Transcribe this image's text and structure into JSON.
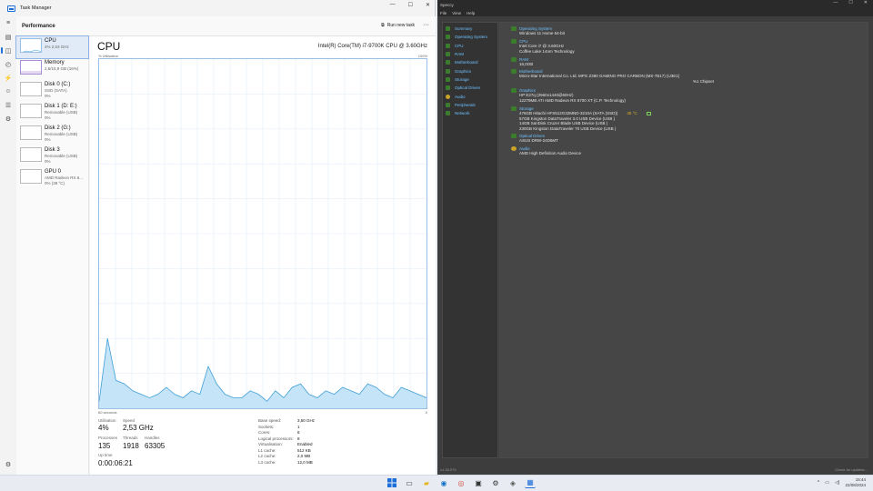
{
  "task_manager": {
    "title": "Task Manager",
    "window_controls": [
      "—",
      "☐",
      "✕"
    ],
    "header": "Performance",
    "run_new_task": "Run new task",
    "more": "···",
    "devices": [
      {
        "name": "CPU",
        "sub1": "4% 2,53 GHz",
        "sub2": "",
        "selected": true
      },
      {
        "name": "Memory",
        "sub1": "2,6/15,9 GB (16%)",
        "sub2": ""
      },
      {
        "name": "Disk 0 (C:)",
        "sub1": "SSD (SATA)",
        "sub2": "0%"
      },
      {
        "name": "Disk 1 (D: E:)",
        "sub1": "Removable (USB)",
        "sub2": "0%"
      },
      {
        "name": "Disk 2 (G:)",
        "sub1": "Removable (USB)",
        "sub2": "0%"
      },
      {
        "name": "Disk 3",
        "sub1": "Removable (USB)",
        "sub2": "0%"
      },
      {
        "name": "GPU 0",
        "sub1": "AMD Radeon RX 6...",
        "sub2": "0% (38 °C)"
      }
    ],
    "cpu": {
      "title": "CPU",
      "model": "Intel(R) Core(TM) i7-9700K CPU @ 3.60GHz",
      "util_label": "% Utilisation",
      "max_label": "100%",
      "seconds_label": "60 seconds",
      "zero_label": "0",
      "stats": {
        "utilisation_label": "Utilisation",
        "utilisation": "4%",
        "speed_label": "Speed",
        "speed": "2,53 GHz",
        "processes_label": "Processes",
        "processes": "135",
        "threads_label": "Threads",
        "threads": "1918",
        "handles_label": "Handles",
        "handles": "63305",
        "uptime_label": "Up time",
        "uptime": "0:00:06:21"
      },
      "details": [
        {
          "k": "Base speed:",
          "v": "3,60 GHz"
        },
        {
          "k": "Sockets:",
          "v": "1"
        },
        {
          "k": "Cores:",
          "v": "8"
        },
        {
          "k": "Logical processors:",
          "v": "8"
        },
        {
          "k": "Virtualisation:",
          "v": "Enabled"
        },
        {
          "k": "L1 cache:",
          "v": "512 KB"
        },
        {
          "k": "L2 cache:",
          "v": "2,0 MB"
        },
        {
          "k": "L3 cache:",
          "v": "12,0 MB"
        }
      ],
      "history_percent": [
        2,
        20,
        8,
        7,
        5,
        4,
        3,
        4,
        6,
        4,
        3,
        5,
        4,
        12,
        7,
        4,
        3,
        3,
        5,
        4,
        2,
        5,
        3,
        6,
        7,
        4,
        3,
        5,
        4,
        6,
        5,
        4,
        7,
        6,
        4,
        3,
        6,
        5,
        4,
        3
      ]
    }
  },
  "speccy": {
    "title": "Speccy",
    "window_controls": [
      "—",
      "☐",
      "✕"
    ],
    "menu": [
      "File",
      "View",
      "Help"
    ],
    "tree": [
      "Summary",
      "Operating System",
      "CPU",
      "RAM",
      "Motherboard",
      "Graphics",
      "Storage",
      "Optical Drives",
      "Audio",
      "Peripherals",
      "Network"
    ],
    "sections": [
      {
        "h": "Operating System",
        "lines": [
          "Windows 11 Home 64-bit"
        ]
      },
      {
        "h": "CPU",
        "lines": [
          "Intel Core i7 @ 3.60GHz",
          "Coffee Lake 14nm Technology"
        ]
      },
      {
        "h": "RAM",
        "lines": [
          "16,0GB"
        ]
      },
      {
        "h": "Motherboard",
        "lines": [
          "Micro-Star International Co. Ltd. MPG Z390 GAMING PRO CARBON (MS-7B17) (U3E1)"
        ],
        "extra": "%1 Chipset"
      },
      {
        "h": "Graphics",
        "lines": [
          "HP E27q (2560x1440@60Hz)",
          "12279MB ATI AMD Radeon RX 6700 XT (C.P. Technology)"
        ]
      },
      {
        "h": "Storage",
        "lines": [
          "476GB Hitachi HFS512G32MND-3210A (SATA (SSD))",
          "57GB Kingston DataTraveler 3.0 USB Device (USB )",
          "14GB SanDisk Cruzer Blade USB Device (USB )",
          "230GB Kingston DataTraveler 70 USB Device (USB )"
        ],
        "temp": "35 °C"
      },
      {
        "h": "Optical Drives",
        "lines": [
          "ASUS DRW-24D5MT"
        ]
      },
      {
        "h": "Audio",
        "lines": [
          "AMD High Definition Audio Device"
        ]
      }
    ],
    "version": "v1.33.079",
    "update": "Check for updates..."
  },
  "taskbar": {
    "time": "15:44",
    "date": "22/08/2024",
    "chevron": "^"
  },
  "colors": {
    "accent": "#1e6fd9",
    "graph_fill": "#c5e4f7",
    "graph_line": "#3f9fd8",
    "speccy_link": "#6ec1ff"
  }
}
